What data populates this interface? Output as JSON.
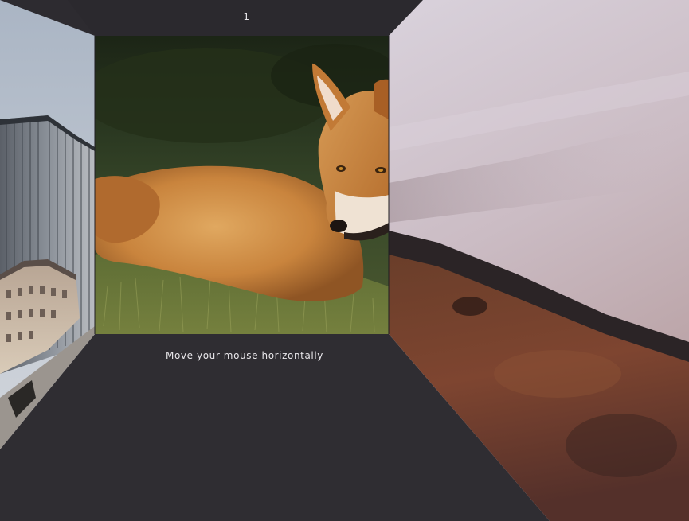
{
  "counter": "-1",
  "hint": "Move your mouse horizontally",
  "panels": {
    "left": {
      "subject": "city-buildings"
    },
    "center": {
      "subject": "red-fox-lying-in-grass"
    },
    "right": {
      "subject": "blurred-sky-and-meadow"
    }
  },
  "colors": {
    "room": "#2d2b30",
    "ceiling": "#2b292e",
    "floor": "#2f2d32",
    "text": "#e8e6ea"
  }
}
